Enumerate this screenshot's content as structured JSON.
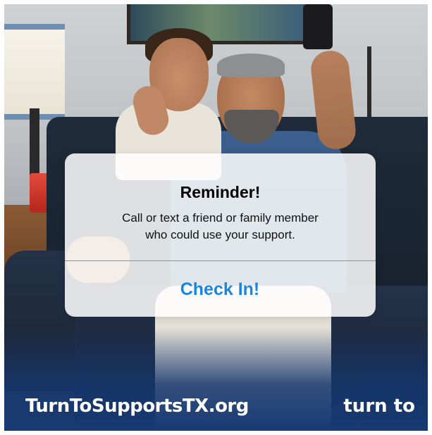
{
  "notification": {
    "title": "Reminder!",
    "message_line1": "Call or text a friend or family member",
    "message_line2": "who could use your support.",
    "action_label": "Check In!"
  },
  "footer": {
    "url": "TurnToSupportsTX.org",
    "brand": "turn to"
  },
  "colors": {
    "accent": "#1a86e0",
    "footer_text": "#ffffff",
    "card_background": "#ffffff"
  }
}
